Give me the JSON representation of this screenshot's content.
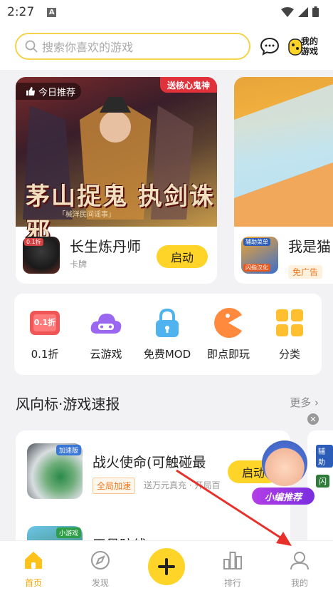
{
  "status_bar": {
    "time": "2:27"
  },
  "header": {
    "search_placeholder": "搜索你喜欢的游戏",
    "my_games_label": "我的游戏"
  },
  "banners": [
    {
      "tag_today": "今日推荐",
      "tag_promo": "送核心鬼神",
      "art_title": "茅山捉鬼 执剑诛邪",
      "art_subtitle": "「械洋民间谣事」",
      "app_name": "长生炼丹师",
      "app_category": "卡牌",
      "icon_badge": "0.1折",
      "button_label": "启动"
    },
    {
      "app_name": "我是猫",
      "icon_badge": "辅助菜单",
      "icon_badge2": "闪指汉化",
      "ad_tag": "免广告"
    }
  ],
  "shortcuts": [
    {
      "label": "0.1折",
      "icon": "discount-ticket-icon",
      "icon_text": "0.1折",
      "color": "#f25555"
    },
    {
      "label": "云游戏",
      "icon": "cloud-gamepad-icon",
      "color": "#9b67f0"
    },
    {
      "label": "免费MOD",
      "icon": "lock-icon",
      "color": "#4fb3f0"
    },
    {
      "label": "即点即玩",
      "icon": "pacman-icon",
      "color": "#ff8a3d"
    },
    {
      "label": "分类",
      "icon": "grid-icon",
      "color": "#ffbf2e"
    }
  ],
  "news": {
    "section_title": "风向标·游戏速报",
    "more_label": "更多",
    "items": [
      {
        "title": "战火使命(可触碰最",
        "tag": "全局加速",
        "desc": "送万元真充 · 开局百",
        "icon_badge": "加速版",
        "button_label": "启动"
      },
      {
        "title": "王号防线",
        "icon_badge": "小游戏"
      }
    ],
    "side_badge": "辅助",
    "side_badge2": "闪"
  },
  "float_promo": {
    "label": "小编推荐"
  },
  "bottom_nav": [
    {
      "label": "首页"
    },
    {
      "label": "发现"
    },
    {
      "label": "排行"
    },
    {
      "label": "我的"
    }
  ],
  "colors": {
    "accent": "#ffd428",
    "active_nav": "#f5a800",
    "promo_red": "#e0323b",
    "annotation_arrow": "#e8302a"
  }
}
